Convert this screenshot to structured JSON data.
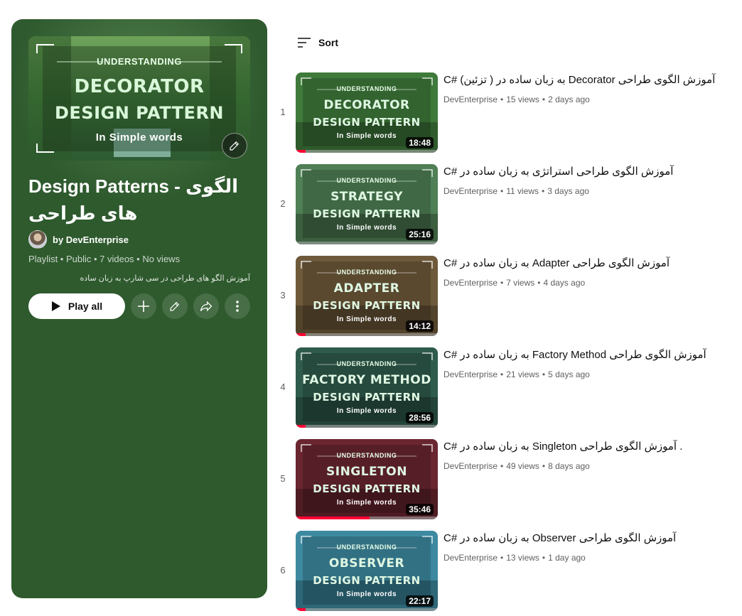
{
  "playlist": {
    "title": "Design Patterns - الگوی های طراحی",
    "owner": "by DevEnterprise",
    "meta": "Playlist • Public • 7 videos • No views",
    "description": "آموزش الگو های طراحی در سی شارپ به زبان ساده",
    "play_all_label": "Play all",
    "accent": "#2e5a2d",
    "hero": {
      "line1": "UNDERSTANDING",
      "line2": "DECORATOR",
      "line3": "DESIGN PATTERN",
      "line4": "In Simple words"
    }
  },
  "sort": {
    "label": "Sort"
  },
  "videos": [
    {
      "index": "1",
      "title": "C# به زبان ساده در ( تزئین) Decorator آموزش الگوی طراحی",
      "channel": "DevEnterprise",
      "views": "15 views",
      "age": "2 days ago",
      "duration": "18:48",
      "thumb": {
        "top": "UNDERSTANDING",
        "main": "DECORATOR",
        "sub": "DESIGN PATTERN",
        "foot": "In Simple words"
      },
      "watched_fraction": 0.07,
      "color": "#3f7a3b"
    },
    {
      "index": "2",
      "title": "C# آموزش الگوی طراحی استراتژی به زبان ساده در",
      "channel": "DevEnterprise",
      "views": "11 views",
      "age": "3 days ago",
      "duration": "25:16",
      "thumb": {
        "top": "UNDERSTANDING",
        "main": "STRATEGY",
        "sub": "DESIGN PATTERN",
        "foot": "In Simple words"
      },
      "watched_fraction": 0.0,
      "color": "#4f7f55"
    },
    {
      "index": "3",
      "title": "C# به زبان ساده در Adapter آموزش الگوی طراحی",
      "channel": "DevEnterprise",
      "views": "7 views",
      "age": "4 days ago",
      "duration": "14:12",
      "thumb": {
        "top": "UNDERSTANDING",
        "main": "ADAPTER",
        "sub": "DESIGN PATTERN",
        "foot": "In Simple words"
      },
      "watched_fraction": 0.07,
      "color": "#6e5a3a"
    },
    {
      "index": "4",
      "title": "C# به زبان ساده در Factory Method آموزش الگوی طراحی",
      "channel": "DevEnterprise",
      "views": "21 views",
      "age": "5 days ago",
      "duration": "28:56",
      "thumb": {
        "top": "UNDERSTANDING",
        "main": "FACTORY METHOD",
        "sub": "DESIGN PATTERN",
        "foot": "In Simple words"
      },
      "watched_fraction": 0.07,
      "color": "#2f5b4c"
    },
    {
      "index": "5",
      "title": "C# به زبان ساده در Singleton آموزش الگوی طراحی .",
      "channel": "DevEnterprise",
      "views": "49 views",
      "age": "8 days ago",
      "duration": "35:46",
      "thumb": {
        "top": "UNDERSTANDING",
        "main": "SINGLETON",
        "sub": "DESIGN PATTERN",
        "foot": "In Simple words"
      },
      "watched_fraction": 0.52,
      "color": "#6a2630"
    },
    {
      "index": "6",
      "title": "C# به زبان ساده در Observer آموزش الگوی طراحی",
      "channel": "DevEnterprise",
      "views": "13 views",
      "age": "1 day ago",
      "duration": "22:17",
      "thumb": {
        "top": "UNDERSTANDING",
        "main": "OBSERVER",
        "sub": "DESIGN PATTERN",
        "foot": "In Simple words"
      },
      "watched_fraction": 0.07,
      "color": "#3d8aa0"
    }
  ],
  "icons": {
    "sort": "sort-lines-icon",
    "play": "play-icon",
    "add": "plus-icon",
    "edit": "pencil-icon",
    "share": "share-icon",
    "more": "more-vert-icon"
  }
}
